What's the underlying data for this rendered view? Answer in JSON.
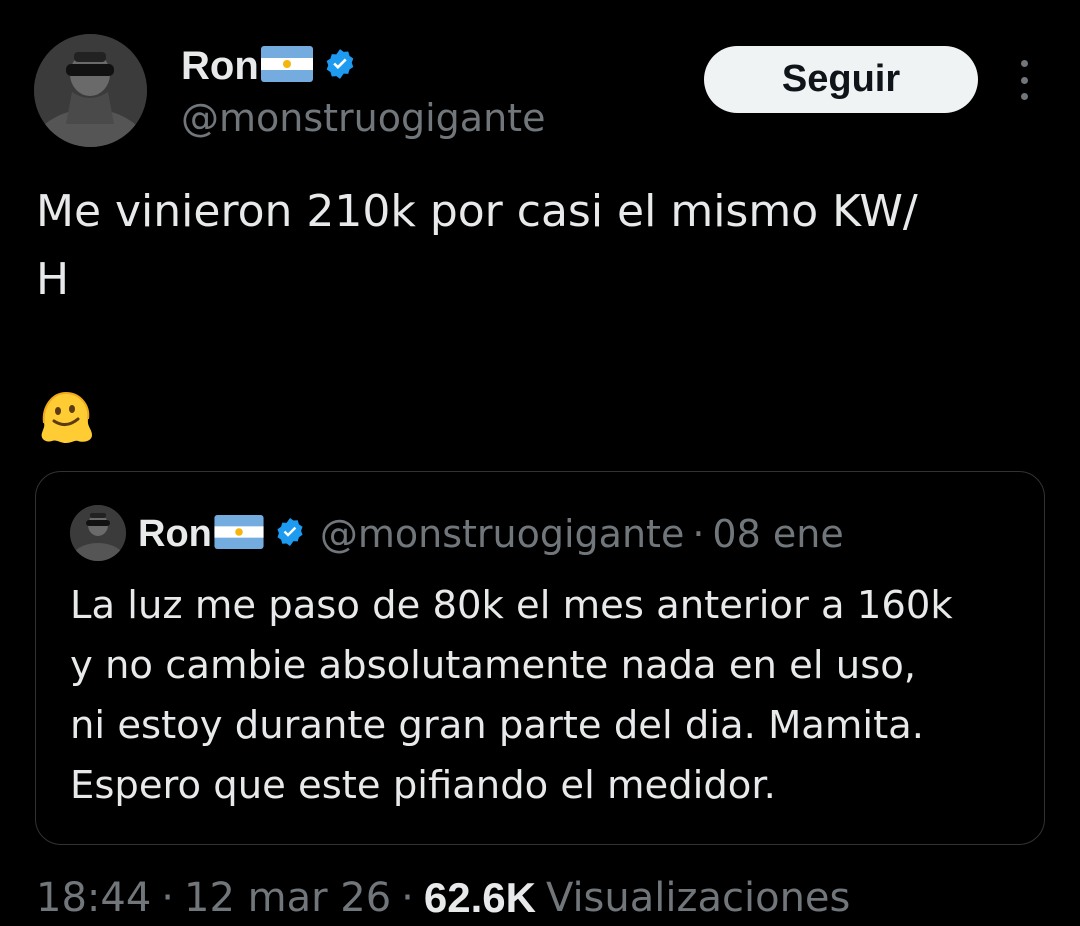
{
  "author": {
    "name": "Ron",
    "flag_icon": "argentina-flag-icon",
    "verified_icon": "verified-badge-icon",
    "handle": "@monstruogigante"
  },
  "actions": {
    "follow_label": "Seguir",
    "more_icon": "more-vertical-icon"
  },
  "tweet": {
    "text": "Me vinieron 210k por casi el mismo KW/\nH",
    "emoji_icon": "melting-face-emoji"
  },
  "quoted": {
    "name": "Ron",
    "handle": "@monstruogigante",
    "separator": "·",
    "date": "08 ene",
    "text": "La luz me paso de 80k el mes anterior a 160k\ny no cambie absolutamente nada en el uso,\nni estoy durante gran parte del dia. Mamita.\nEspero que este pifiando el medidor."
  },
  "meta": {
    "time": "18:44",
    "separator": "·",
    "date": "12 mar 26",
    "views_count": "62.6K",
    "views_label": "Visualizaciones"
  },
  "colors": {
    "background": "#000000",
    "text_primary": "#e7e9ea",
    "text_secondary": "#71767b",
    "verified_blue": "#1d9bf0",
    "border": "#2f3336",
    "button_bg": "#eff3f4"
  }
}
